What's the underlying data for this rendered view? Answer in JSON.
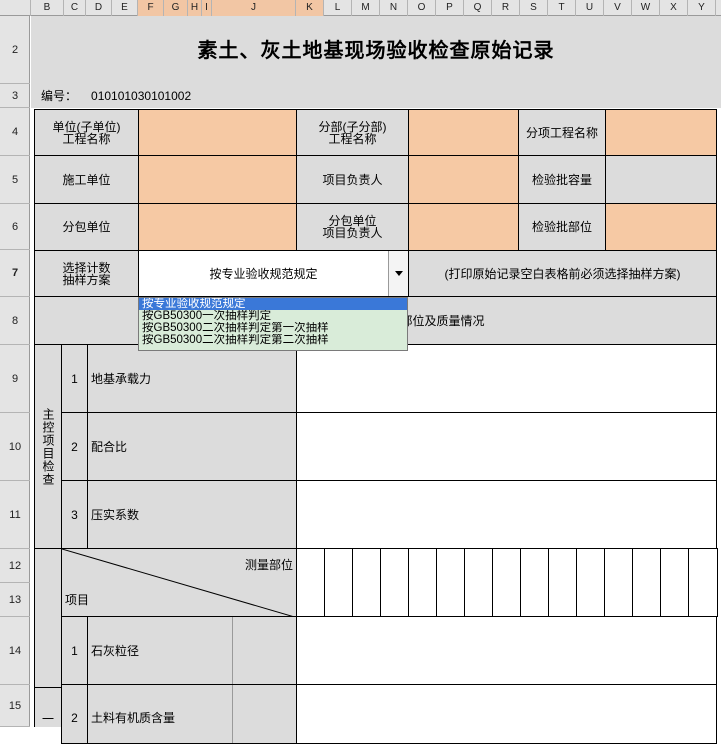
{
  "columns": [
    "B",
    "C",
    "D",
    "E",
    "F",
    "G",
    "H",
    "I",
    "J",
    "K",
    "L",
    "M",
    "N",
    "O",
    "P",
    "Q",
    "R",
    "S",
    "T",
    "U",
    "V",
    "W",
    "X",
    "Y"
  ],
  "rows": [
    "2",
    "3",
    "4",
    "5",
    "6",
    "7",
    "8",
    "9",
    "10",
    "11",
    "12",
    "13",
    "14",
    "15"
  ],
  "title": "素土、灰土地基现场验收检查原始记录",
  "code_label": "编号：",
  "code_value": "010101030101002",
  "fields": {
    "unit_name": "单位(子单位)\n工程名称",
    "division_name": "分部(子分部)\n工程名称",
    "subitem_name": "分项工程名称",
    "contractor": "施工单位",
    "project_manager": "项目负责人",
    "batch_capacity": "检验批容量",
    "subcontractor": "分包单位",
    "sub_manager": "分包单位\n项目负责人",
    "batch_location": "检验批部位",
    "sampling_label": "选择计数\n抽样方案",
    "sampling_value": "按专业验收规范规定",
    "sampling_note": "(打印原始记录空白表格前必须选择抽样方案)",
    "inspect_header": "检查部位及质量情况"
  },
  "dropdown": {
    "options": [
      "按专业验收规范规定",
      "按GB50300一次抽样判定",
      "按GB50300二次抽样判定第一次抽样",
      "按GB50300二次抽样判定第二次抽样"
    ],
    "selected_index": 0
  },
  "main_control": {
    "label": "主控项目检查",
    "items": [
      {
        "no": "1",
        "name": "地基承载力"
      },
      {
        "no": "2",
        "name": "配合比"
      },
      {
        "no": "3",
        "name": "压实系数"
      }
    ]
  },
  "measure": {
    "position_label": "测量部位",
    "item_label": "项目"
  },
  "general": {
    "label": "一",
    "items": [
      {
        "no": "1",
        "name": "石灰粒径"
      },
      {
        "no": "2",
        "name": "土料有机质含量"
      }
    ]
  },
  "colors": {
    "peach": "#f6c9a4",
    "gray": "#dcdcdc",
    "dropdown_green": "#d9ecd9",
    "highlight_blue": "#3a78d8"
  }
}
